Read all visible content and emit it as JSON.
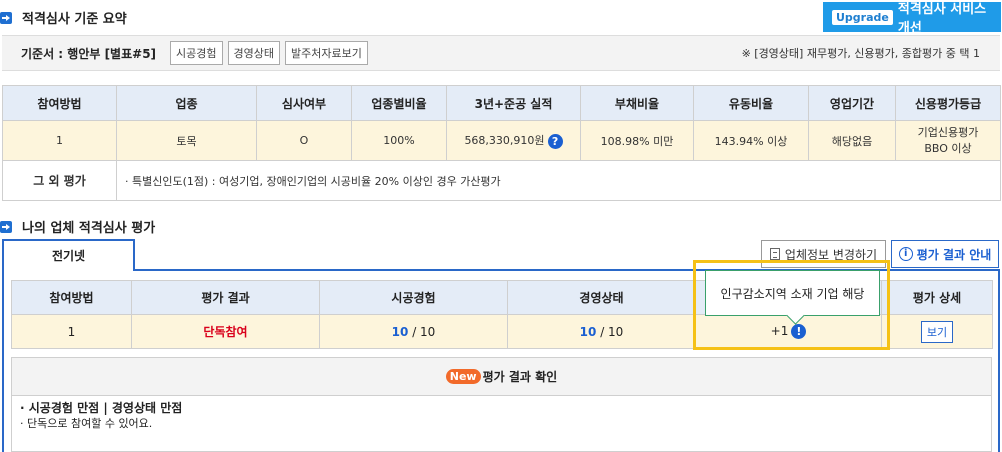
{
  "section1": {
    "title": "적격심사 기준 요약"
  },
  "upgrade": {
    "tag": "Upgrade",
    "label": "적격심사 서비스 개선"
  },
  "criteria": {
    "label": "기준서 : 행안부 [별표#5]",
    "tags": [
      "시공경험",
      "경영상태",
      "발주처자료보기"
    ],
    "note": "※ [경영상태] 재무평가, 신용평가, 종합평가 중 택 1"
  },
  "summary_table": {
    "headers": [
      "참여방법",
      "업종",
      "심사여부",
      "업종별비율",
      "3년+준공 실적",
      "부채비율",
      "유동비율",
      "영업기간",
      "신용평가등급"
    ],
    "row": [
      "1",
      "토목",
      "O",
      "100%",
      "568,330,910원",
      "108.98% 미만",
      "143.94% 이상",
      "해당없음",
      "기업신용평가\nBBO 이상"
    ],
    "credit_line1": "기업신용평가",
    "credit_line2": "BBO 이상",
    "help_icon": "question-icon",
    "other_label": "그 외 평가",
    "other_text": "· 특별신인도(1점) : 여성기업, 장애인기업의 시공비율 20% 이상인 경우 가산평가"
  },
  "section2": {
    "title": "나의 업체 적격심사 평가"
  },
  "tab": {
    "label": "전기넷"
  },
  "buttons": {
    "change_info": "업체정보 변경하기",
    "guide": "평가 결과 안내"
  },
  "eval_table": {
    "headers": [
      "참여방법",
      "평가 결과",
      "시공경험",
      "경영상태",
      "",
      "평가 상세"
    ],
    "method": "1",
    "result": "단독참여",
    "construction_score": "10",
    "construction_total": " / 10",
    "management_score": "10",
    "management_total": " / 10",
    "bonus": "+1",
    "view": "보기"
  },
  "tooltip": {
    "text": "인구감소지역 소재 기업 해당"
  },
  "result_box": {
    "badge": "New",
    "title": "평가 결과 확인",
    "line1": "· 시공경험 만점 | 경영상태 만점",
    "line2": "· 단독으로 참여할 수 있어요."
  },
  "colors": {
    "accent": "#1a5fd1",
    "header_bg": "#e4ecf7",
    "row_bg": "#fdf5dc",
    "highlight": "#f5c116"
  }
}
